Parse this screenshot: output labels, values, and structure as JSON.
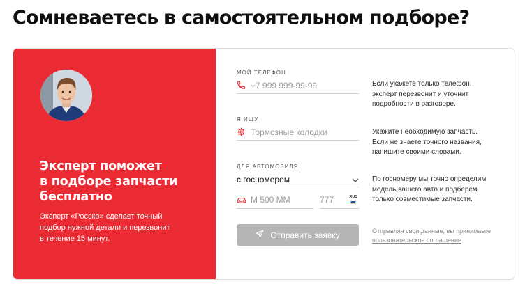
{
  "title": "Сомневаетесь в самостоятельном подборе?",
  "promo": {
    "heading_lines": [
      "Эксперт поможет",
      "в подборе запчасти",
      "бесплатно"
    ],
    "text_lines": [
      "Эксперт «Росско» сделает точный",
      "подбор нужной детали и перезвонит",
      "в течение 15 минут."
    ]
  },
  "form": {
    "phone": {
      "label": "МОЙ ТЕЛЕФОН",
      "placeholder": "+7 999 999-99-99",
      "value": "",
      "icon": "phone-icon",
      "hint_lines": [
        "Если укажете только телефон,",
        "эксперт перезвонит и уточнит",
        "подробности в разговоре."
      ]
    },
    "part": {
      "label": "Я ИЩУ",
      "placeholder": "Тормозные колодки",
      "value": "",
      "icon": "gear-icon",
      "hint_lines": [
        "Укажите необходимую запчасть.",
        "Если не знаете точного названия,",
        "напишите своими словами."
      ]
    },
    "car": {
      "label": "ДЛЯ АВТОМОБИЛЯ",
      "selected": "с госномером",
      "plate_placeholder": "М 500 ММ",
      "region_placeholder": "777",
      "country": "RUS",
      "icon": "car-icon",
      "hint_lines": [
        "По госномеру мы точно определим",
        "модель вашего авто и подберем",
        "только совместимые запчасти."
      ]
    },
    "submit_label": "Отправить заявку",
    "consent_text": "Отправляя свои данные, вы принимаете",
    "consent_link": "пользовательское соглашение"
  },
  "colors": {
    "brand_red": "#ea2b34",
    "button_disabled": "#b5b5b5",
    "flag": [
      "#ffffff",
      "#1f4fb5",
      "#d52b1e"
    ]
  }
}
